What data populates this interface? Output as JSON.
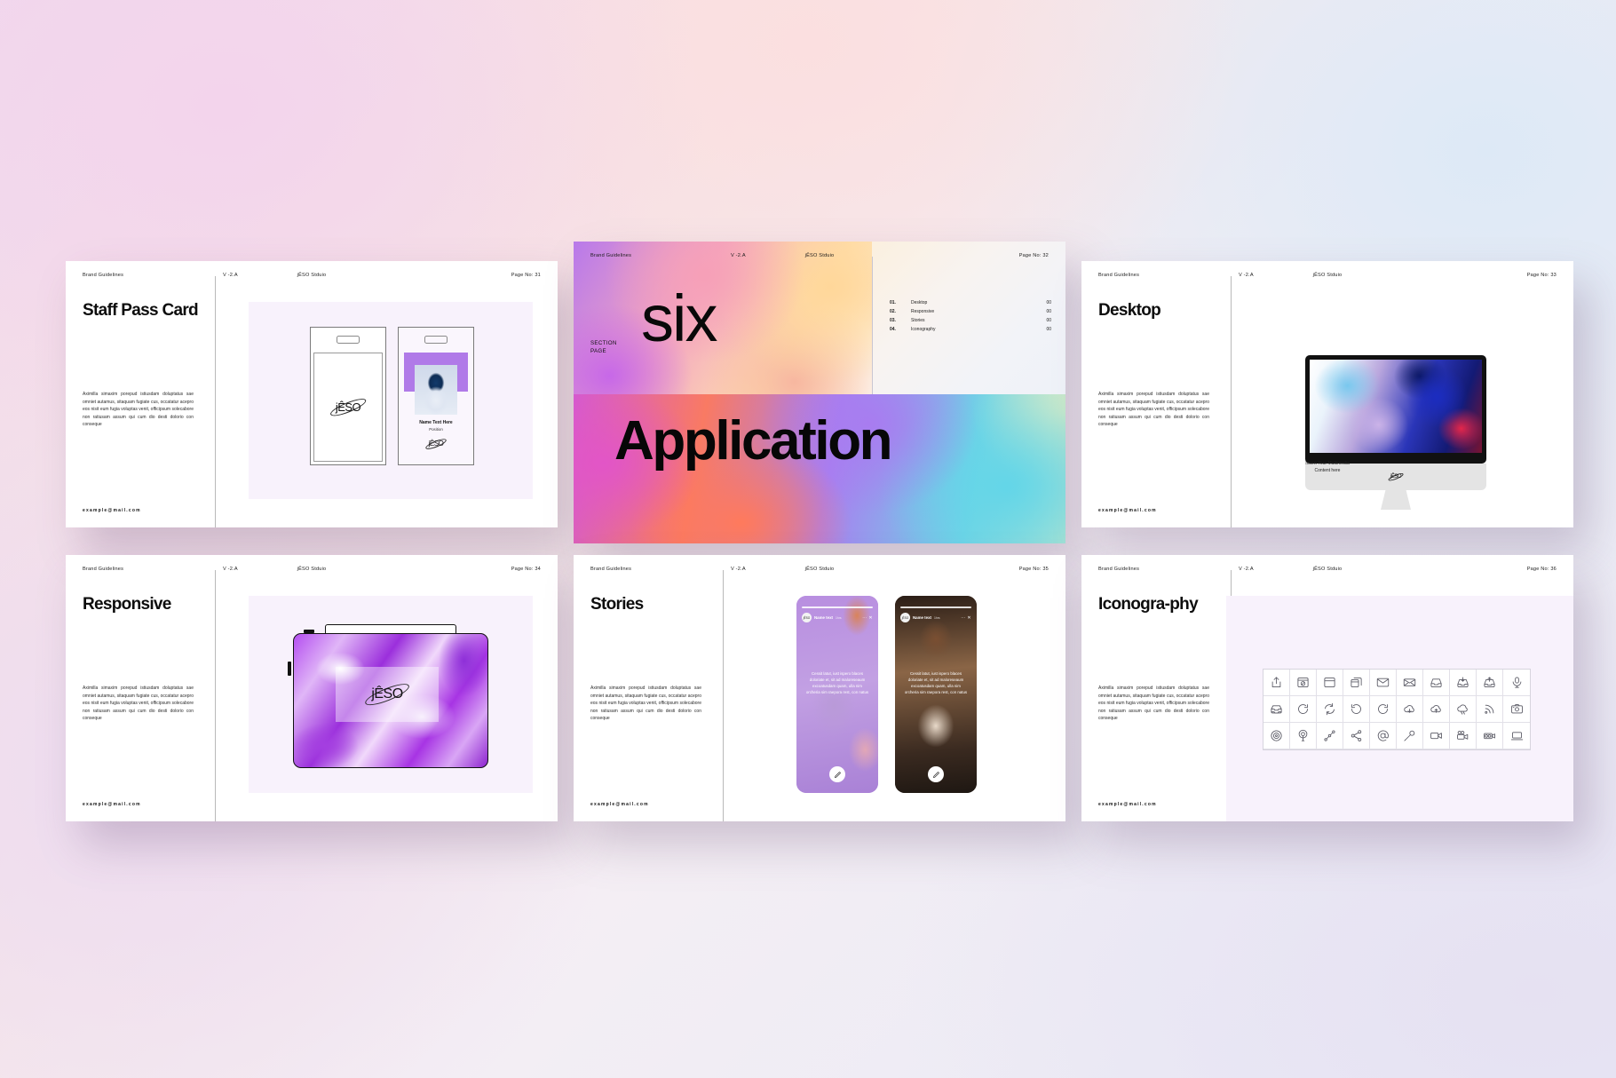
{
  "common": {
    "brand": "Brand Guidelines",
    "version": "V -2.A",
    "studio": "jÊSO Stduio",
    "email": "example@mail.com",
    "body_copy": "Aximilla simaxim porepud istiusdam doluptatus sae omniet autamus, sitaquam fugiate cus, occatatur acepro eos nisit eum fugia voluptas venit, officipsum solecabore non ratiusam assum qui cum dio desti dolorio con conseque",
    "logo": "jÊSO"
  },
  "slides": {
    "staff_pass": {
      "page": "Page No: 31",
      "title": "Staff Pass Card",
      "badge_name": "Name Text Here",
      "badge_position": "Position"
    },
    "section": {
      "page": "Page No: 32",
      "section_label_line1": "SECTION",
      "section_label_line2": "PAGE",
      "word_six": "six",
      "word_application": "Application",
      "toc": [
        {
          "num": "01.",
          "label": "Desktop",
          "value": "00"
        },
        {
          "num": "02.",
          "label": "Responsive",
          "value": "00"
        },
        {
          "num": "03.",
          "label": "Stories",
          "value": "00"
        },
        {
          "num": "04.",
          "label": "Iconography",
          "value": "00"
        }
      ]
    },
    "desktop": {
      "page": "Page No: 33",
      "title": "Desktop",
      "screen_logo": "jÊSO",
      "caption_line1": "Insert Your Multimedia",
      "caption_line2": "Content here"
    },
    "responsive": {
      "page": "Page No: 34",
      "title": "Responsive",
      "device_logo": "jÊSO"
    },
    "stories": {
      "page": "Page No: 35",
      "title": "Stories",
      "cards": [
        {
          "avatar": "jÊSO",
          "name": "Name text",
          "time": "1hrs",
          "menu": "⋯ ✕",
          "text": "Cessit latut, iust ispero blaces doloriate et, sit ad maloreseaum excoatusdam quam, ulla nim orcheria sim raepora rest, con natus"
        },
        {
          "avatar": "jÊSO",
          "name": "Name text",
          "time": "1hrs",
          "menu": "⋯ ✕",
          "text": "Cessit latut, iust ispero blaces doloriate et, sit ad maloreseaum excoatusdam quam, ulla nim orcheria sim raepora rest, con natus"
        }
      ]
    },
    "iconography": {
      "page": "Page No: 36",
      "title": "Iconogra-phy",
      "icons": [
        "share-box-icon",
        "browser-block-icon",
        "window-icon",
        "windows-stack-icon",
        "mail-icon",
        "mail-open-icon",
        "inbox-icon",
        "inbox-download-icon",
        "inbox-upload-icon",
        "microphone-icon",
        "inbox-stack-icon",
        "refresh-icon",
        "sync-icon",
        "rotate-left-icon",
        "rotate-right-icon",
        "cloud-download-icon",
        "cloud-upload-icon",
        "cloud-sync-icon",
        "rss-icon",
        "camera-front-icon",
        "broadcast-icon",
        "podcast-icon",
        "node-path-icon",
        "share-nodes-icon",
        "at-sign-icon",
        "mic-handheld-icon",
        "video-camera-icon",
        "film-camera-icon",
        "camcorder-icon",
        "laptop-icon"
      ]
    }
  },
  "colors": {
    "accent_purple": "#b07ae8",
    "ink": "#0d0d0d",
    "panel": "#f8f2fc"
  }
}
